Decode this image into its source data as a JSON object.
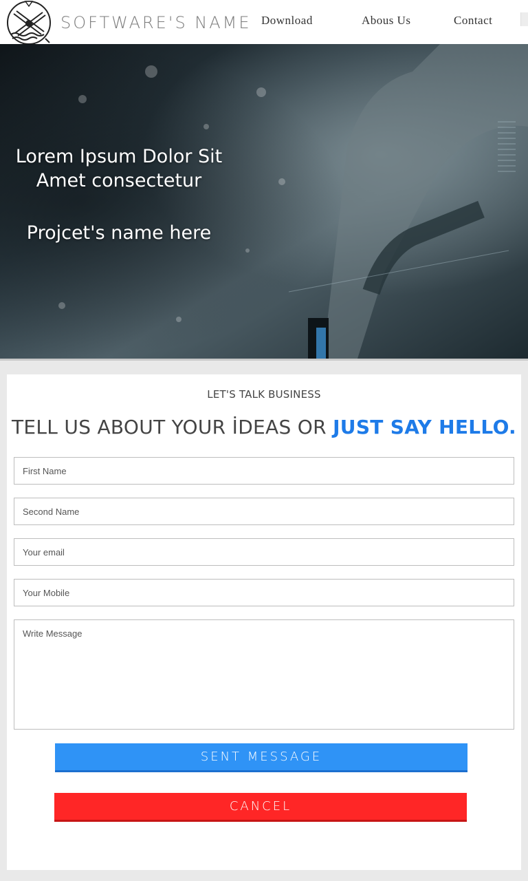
{
  "header": {
    "brand": "SOFTWARE'S NAME",
    "nav": {
      "download": "Download",
      "about": "Abous Us",
      "contact": "Contact"
    }
  },
  "hero": {
    "title_line1": "Lorem Ipsum Dolor Sit",
    "title_line2": "Amet consectetur",
    "project": "Projcet's name here"
  },
  "contact": {
    "kicker": "LET'S TALK BUSINESS",
    "headline_main": "TELL US ABOUT YOUR İDEAS OR ",
    "headline_accent": "JUST SAY HELLO.",
    "fields": {
      "first_name": "First Name",
      "second_name": "Second Name",
      "email": "Your email",
      "mobile": "Your Mobile",
      "message": "Write Message"
    },
    "send_label": "SENT MESSAGE",
    "cancel_label": "CANCEL"
  },
  "colors": {
    "accent_blue": "#1e7be8",
    "send_button": "#2f93f6",
    "cancel_button": "#ff2626"
  }
}
